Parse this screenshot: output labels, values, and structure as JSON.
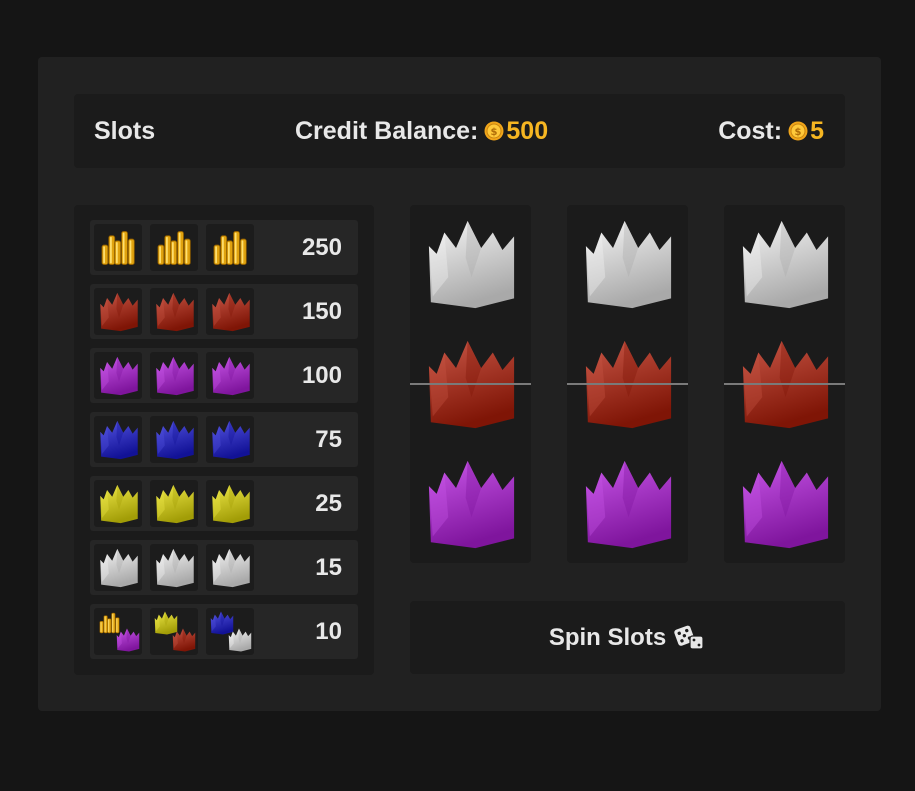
{
  "header": {
    "title": "Slots",
    "balance_label": "Credit Balance:",
    "balance_value": "500",
    "cost_label": "Cost:",
    "cost_value": "5",
    "coin_icon": "coin-icon"
  },
  "paytable": [
    {
      "symbols": [
        "coins",
        "coins",
        "coins"
      ],
      "payout": "250"
    },
    {
      "symbols": [
        "red-hat",
        "red-hat",
        "red-hat"
      ],
      "payout": "150"
    },
    {
      "symbols": [
        "purple-hat",
        "purple-hat",
        "purple-hat"
      ],
      "payout": "100"
    },
    {
      "symbols": [
        "blue-hat",
        "blue-hat",
        "blue-hat"
      ],
      "payout": "75"
    },
    {
      "symbols": [
        "yellow-hat",
        "yellow-hat",
        "yellow-hat"
      ],
      "payout": "25"
    },
    {
      "symbols": [
        "white-hat",
        "white-hat",
        "white-hat"
      ],
      "payout": "15"
    },
    {
      "symbols": [
        "any-two",
        "any-two",
        "any-two"
      ],
      "payout": "10"
    }
  ],
  "reels": [
    [
      "white-hat",
      "red-hat",
      "purple-hat"
    ],
    [
      "white-hat",
      "red-hat",
      "purple-hat"
    ],
    [
      "white-hat",
      "red-hat",
      "purple-hat"
    ]
  ],
  "spin_button": {
    "label": "Spin Slots",
    "icon": "dice-icon"
  },
  "colors": {
    "background": "#151515",
    "panel": "#212121",
    "gold": "#f6b622",
    "red-hat": "#b51e08",
    "purple-hat": "#b51ee0",
    "blue-hat": "#1a1ad6",
    "yellow-hat": "#e8e00a",
    "white-hat": "#f2f2f2"
  }
}
